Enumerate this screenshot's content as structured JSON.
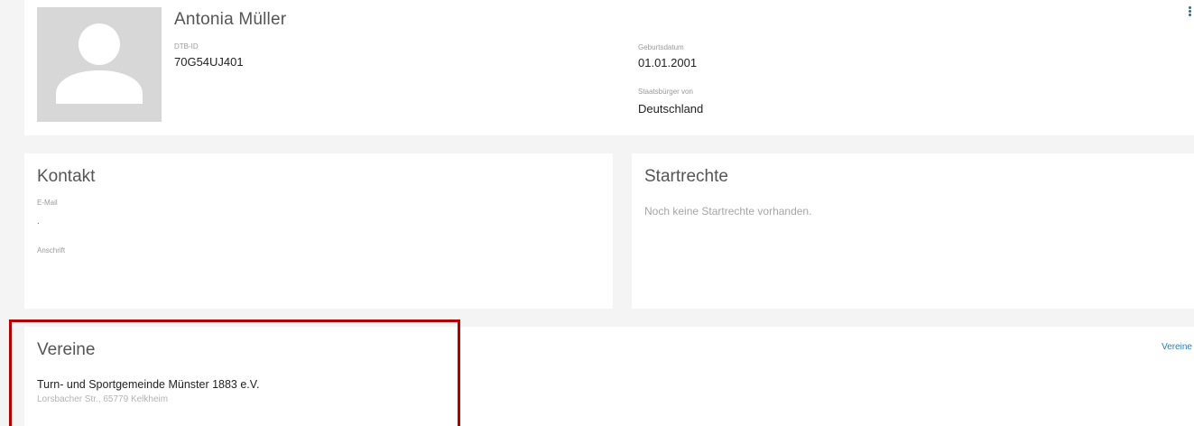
{
  "profile": {
    "name": "Antonia Müller",
    "dtb_id_label": "DTB-ID",
    "dtb_id_value": "70G54UJ401",
    "birthdate_label": "Geburtsdatum",
    "birthdate_value": "01.01.2001",
    "citizenship_label": "Staatsbürger von",
    "citizenship_value": "Deutschland",
    "menu_icon": "more-vertical-icon",
    "avatar_icon": "person-placeholder-icon"
  },
  "contact": {
    "title": "Kontakt",
    "email_label": "E-Mail",
    "email_value": ".",
    "address_label": "Anschrift"
  },
  "start_rights": {
    "title": "Startrechte",
    "empty_text": "Noch keine Startrechte vorhanden."
  },
  "clubs": {
    "title": "Vereine",
    "link_label": "Vereine",
    "items": [
      {
        "name": "Turn- und Sportgemeinde Münster 1883 e.V.",
        "address": "Lorsbacher Str., 65779 Kelkheim"
      }
    ]
  },
  "colors": {
    "highlight": "#b00000",
    "link": "#2a7fb8",
    "background": "#f4f4f4"
  }
}
